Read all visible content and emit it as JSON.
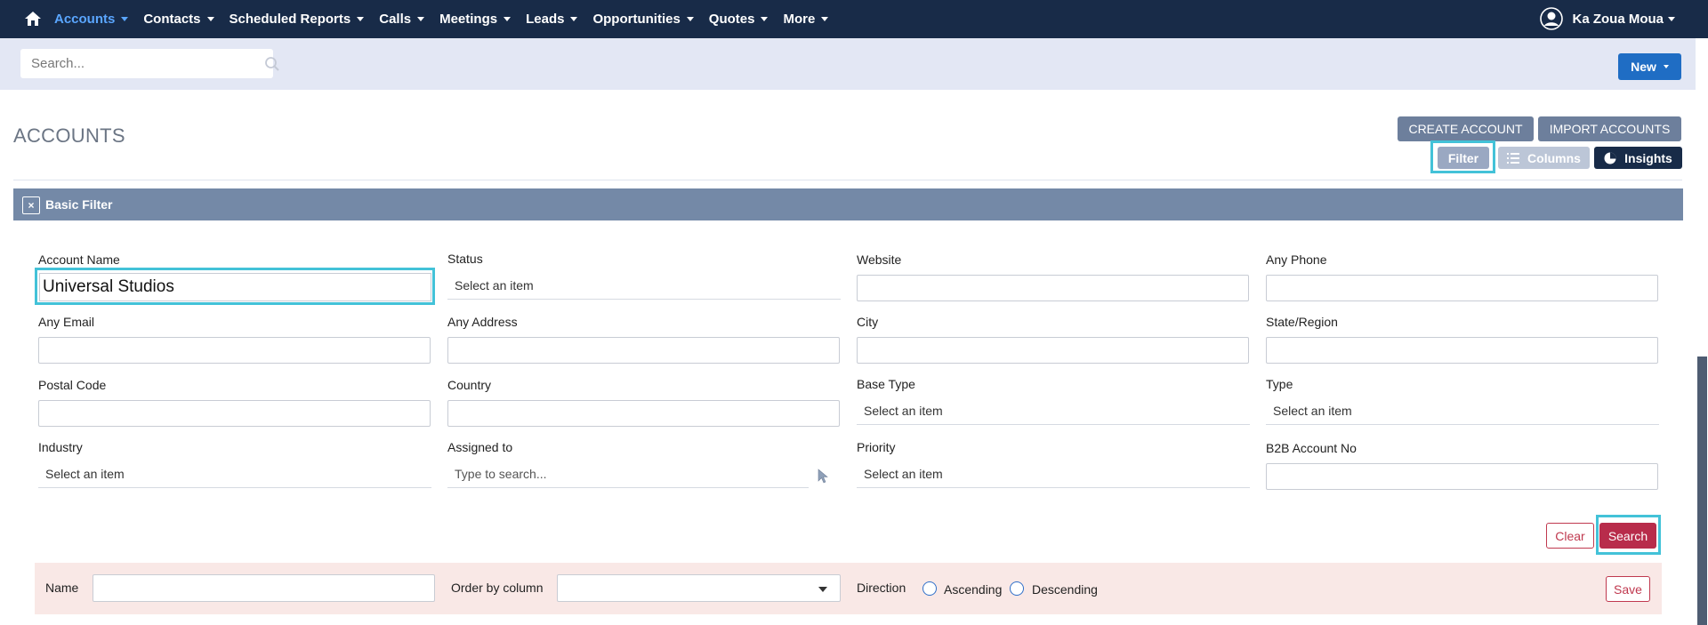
{
  "nav": {
    "items": [
      {
        "label": "Accounts",
        "active": true
      },
      {
        "label": "Contacts"
      },
      {
        "label": "Scheduled Reports"
      },
      {
        "label": "Calls"
      },
      {
        "label": "Meetings"
      },
      {
        "label": "Leads"
      },
      {
        "label": "Opportunities"
      },
      {
        "label": "Quotes"
      },
      {
        "label": "More"
      }
    ],
    "user_name": "Ka Zoua Moua"
  },
  "global_search": {
    "placeholder": "Search..."
  },
  "new_button": "New",
  "page": {
    "title": "ACCOUNTS",
    "create_button": "CREATE ACCOUNT",
    "import_button": "IMPORT ACCOUNTS",
    "filter_button": "Filter",
    "columns_button": "Columns",
    "insights_button": "Insights"
  },
  "filter": {
    "title": "Basic Filter",
    "close_glyph": "×",
    "fields": {
      "account_name": {
        "label": "Account Name",
        "value": "Universal Studios"
      },
      "status": {
        "label": "Status",
        "value": "Select an item"
      },
      "website": {
        "label": "Website"
      },
      "any_phone": {
        "label": "Any Phone"
      },
      "any_email": {
        "label": "Any Email"
      },
      "any_address": {
        "label": "Any Address"
      },
      "city": {
        "label": "City"
      },
      "state_region": {
        "label": "State/Region"
      },
      "postal_code": {
        "label": "Postal Code"
      },
      "country": {
        "label": "Country"
      },
      "base_type": {
        "label": "Base Type",
        "value": "Select an item"
      },
      "type": {
        "label": "Type",
        "value": "Select an item"
      },
      "industry": {
        "label": "Industry",
        "value": "Select an item"
      },
      "assigned_to": {
        "label": "Assigned to",
        "placeholder": "Type to search..."
      },
      "priority": {
        "label": "Priority",
        "value": "Select an item"
      },
      "b2b_account_no": {
        "label": "B2B Account No"
      }
    },
    "clear_button": "Clear",
    "search_button": "Search"
  },
  "saved_filter": {
    "name_label": "Name",
    "order_by_label": "Order by column",
    "direction_label": "Direction",
    "ascending_label": "Ascending",
    "descending_label": "Descending",
    "save_button": "Save"
  },
  "colors": {
    "nav_bg": "#182b48",
    "active_nav": "#5aa6ff",
    "filter_header": "#7489a7",
    "primary": "#1f6dc4",
    "danger": "#b82c4b",
    "highlight": "#43c2d8"
  }
}
